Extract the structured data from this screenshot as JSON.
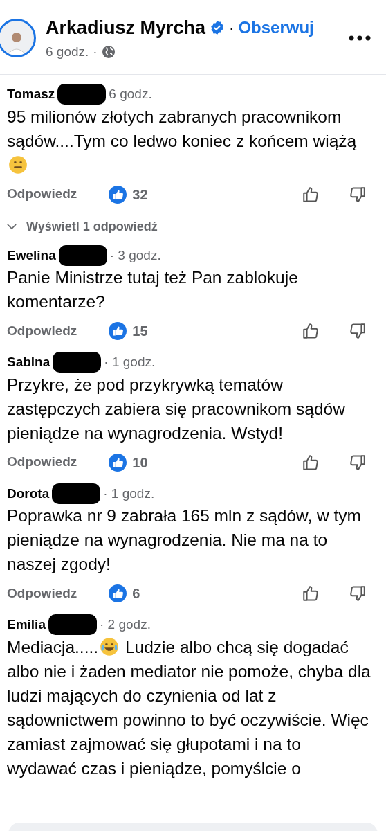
{
  "post": {
    "author": "Arkadiusz Myrcha",
    "verified": true,
    "separator": "·",
    "follow": "Obserwuj",
    "time": "6 godz.",
    "time_separator": "·"
  },
  "comments": [
    {
      "author": "Tomasz",
      "redacted": true,
      "time": "6 godz.",
      "segments": [
        {
          "kind": "text",
          "text": "95 milionów złotych zabranych pracownikom sądów....Tym co ledwo koniec z końcem wiążą"
        },
        {
          "kind": "neutral-emoji"
        }
      ],
      "reply": "Odpowiedz",
      "likes": "32",
      "replies_toggle": "Wyświetl 1 odpowiedź"
    },
    {
      "author": "Ewelina",
      "redacted": true,
      "time": "· 3 godz.",
      "segments": [
        {
          "kind": "text",
          "text": "Panie Ministrze tutaj też Pan zablokuje komentarze?"
        }
      ],
      "reply": "Odpowiedz",
      "likes": "15"
    },
    {
      "author": "Sabina",
      "redacted": true,
      "time": "· 1 godz.",
      "segments": [
        {
          "kind": "text",
          "text": "Przykre, że pod przykrywką tematów zastępczych zabiera się pracownikom sądów pieniądze na wynagrodzenia. Wstyd!"
        }
      ],
      "reply": "Odpowiedz",
      "likes": "10"
    },
    {
      "author": "Dorota",
      "redacted": true,
      "time": "· 1 godz.",
      "segments": [
        {
          "kind": "text",
          "text": "Poprawka nr 9 zabrała 165 mln z sądów, w tym pieniądze na wynagrodzenia. Nie ma na to naszej zgody!"
        }
      ],
      "reply": "Odpowiedz",
      "likes": "6"
    },
    {
      "author": "Emilia",
      "redacted": true,
      "time": "· 2 godz.",
      "segments": [
        {
          "kind": "text",
          "text": "Mediacja....."
        },
        {
          "kind": "laughing-emoji"
        },
        {
          "kind": "text",
          "text": " Ludzie albo chcą się dogadać albo nie i żaden mediator nie pomoże, chyba dla ludzi mających do czynienia od lat z sądownictwem powinno to być oczywiście. Więc zamiast zajmować się głupotami i na to wydawać czas i pieniądze, pomyślcie o"
        }
      ]
    }
  ]
}
